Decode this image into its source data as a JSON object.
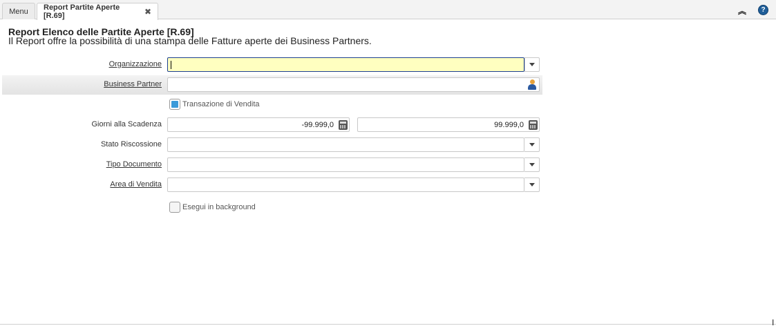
{
  "tabs": {
    "menu_label": "Menu",
    "active_label": "Report Partite Aperte [R.69]",
    "close_glyph": "✖"
  },
  "toolbar": {
    "collapse_icon": "chevrons-up-icon",
    "help_icon": "help-icon"
  },
  "header": {
    "title": "Report Elenco delle Partite Aperte [R.69]",
    "description": "Il Report offre la possibilità di una stampa delle Fatture aperte dei Business Partners."
  },
  "form": {
    "organizzazione": {
      "label": "Organizzazione",
      "value": ""
    },
    "business_partner": {
      "label": "Business Partner",
      "value": ""
    },
    "transazione_vendita": {
      "label": "Transazione di Vendita",
      "checked": true
    },
    "giorni_scadenza": {
      "label": "Giorni alla Scadenza",
      "from": "-99.999,0",
      "to": "99.999,0"
    },
    "stato_riscossione": {
      "label": "Stato Riscossione",
      "value": ""
    },
    "tipo_documento": {
      "label": "Tipo Documento",
      "value": ""
    },
    "area_vendita": {
      "label": "Area di Vendita",
      "value": ""
    },
    "background": {
      "label": "Esegui in background",
      "checked": false
    }
  },
  "colors": {
    "focus_bg": "#ffffc0",
    "focus_border": "#1b3f8f",
    "checkbox_fill": "#3a9ad9"
  }
}
